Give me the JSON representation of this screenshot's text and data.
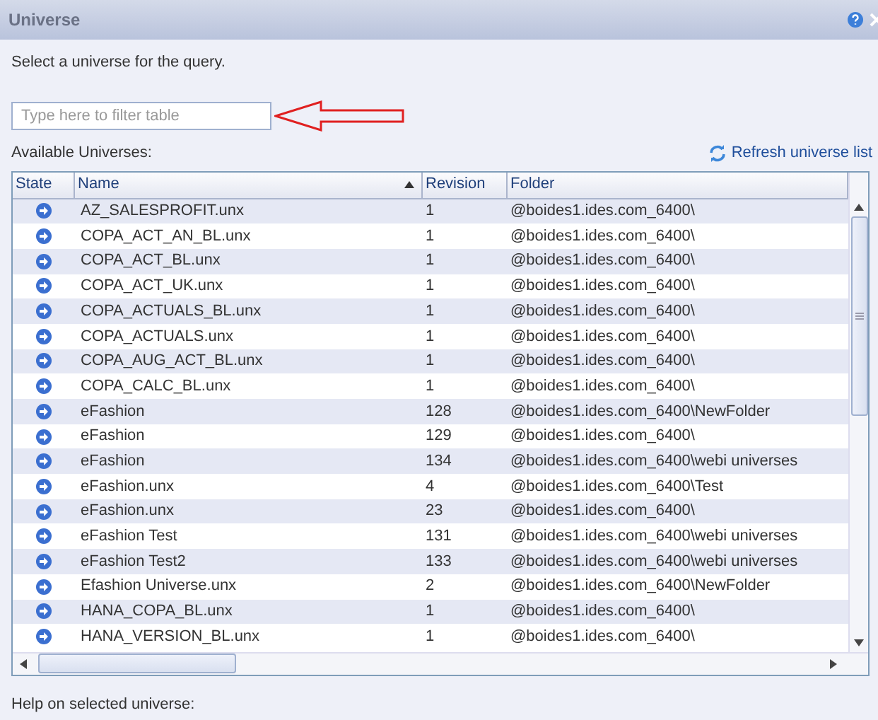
{
  "window": {
    "title": "Universe"
  },
  "instruction": "Select a universe for the query.",
  "filter": {
    "placeholder": "Type here to filter table"
  },
  "list_label": "Available Universes:",
  "refresh_link": "Refresh universe list",
  "table": {
    "columns": [
      {
        "label": "State",
        "sorted": false
      },
      {
        "label": "Name",
        "sorted": true
      },
      {
        "label": "Revision",
        "sorted": false
      },
      {
        "label": "Folder",
        "sorted": false
      }
    ],
    "rows": [
      {
        "name": "AZ_SALESPROFIT.unx",
        "revision": "1",
        "folder": "@boides1.ides.com_6400\\"
      },
      {
        "name": "COPA_ACT_AN_BL.unx",
        "revision": "1",
        "folder": "@boides1.ides.com_6400\\"
      },
      {
        "name": "COPA_ACT_BL.unx",
        "revision": "1",
        "folder": "@boides1.ides.com_6400\\"
      },
      {
        "name": "COPA_ACT_UK.unx",
        "revision": "1",
        "folder": "@boides1.ides.com_6400\\"
      },
      {
        "name": "COPA_ACTUALS_BL.unx",
        "revision": "1",
        "folder": "@boides1.ides.com_6400\\"
      },
      {
        "name": "COPA_ACTUALS.unx",
        "revision": "1",
        "folder": "@boides1.ides.com_6400\\"
      },
      {
        "name": "COPA_AUG_ACT_BL.unx",
        "revision": "1",
        "folder": "@boides1.ides.com_6400\\"
      },
      {
        "name": "COPA_CALC_BL.unx",
        "revision": "1",
        "folder": "@boides1.ides.com_6400\\"
      },
      {
        "name": "eFashion",
        "revision": "128",
        "folder": "@boides1.ides.com_6400\\NewFolder"
      },
      {
        "name": "eFashion",
        "revision": "129",
        "folder": "@boides1.ides.com_6400\\"
      },
      {
        "name": "eFashion",
        "revision": "134",
        "folder": "@boides1.ides.com_6400\\webi universes"
      },
      {
        "name": "eFashion.unx",
        "revision": "4",
        "folder": "@boides1.ides.com_6400\\Test"
      },
      {
        "name": "eFashion.unx",
        "revision": "23",
        "folder": "@boides1.ides.com_6400\\"
      },
      {
        "name": "eFashion Test",
        "revision": "131",
        "folder": "@boides1.ides.com_6400\\webi universes"
      },
      {
        "name": "eFashion Test2",
        "revision": "133",
        "folder": "@boides1.ides.com_6400\\webi universes"
      },
      {
        "name": "Efashion Universe.unx",
        "revision": "2",
        "folder": "@boides1.ides.com_6400\\NewFolder"
      },
      {
        "name": "HANA_COPA_BL.unx",
        "revision": "1",
        "folder": "@boides1.ides.com_6400\\"
      },
      {
        "name": "HANA_VERSION_BL.unx",
        "revision": "1",
        "folder": "@boides1.ides.com_6400\\"
      }
    ]
  },
  "help_label": "Help on selected universe:"
}
